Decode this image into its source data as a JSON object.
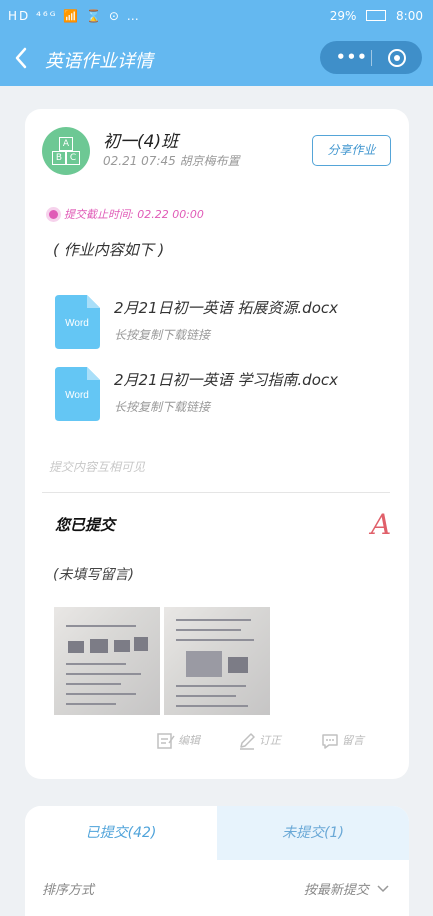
{
  "status_bar": {
    "left": "HD ⁴⁶ᴳ 📶 ⌛ ⊙ … ",
    "battery": "29%",
    "time": "8:00"
  },
  "nav": {
    "title": "英语作业详情",
    "more": "•••"
  },
  "homework": {
    "class_name": "初一(4)班",
    "meta": "02.21 07:45 胡京梅布置",
    "share_label": "分享作业",
    "deadline": "提交截止时间: 02.22 00:00",
    "content_title": "( 作业内容如下 )",
    "files": [
      {
        "name": "2月21日初一英语 拓展资源.docx",
        "hint": "长按复制下载链接",
        "icon_label": "Word"
      },
      {
        "name": "2月21日初一英语 学习指南.docx",
        "hint": "长按复制下载链接",
        "icon_label": "Word"
      }
    ],
    "visibility_note": "提交内容互相可见"
  },
  "submission": {
    "title": "您已提交",
    "grade": "A",
    "comment": "(未填写留言)",
    "actions": {
      "edit": "编辑",
      "revise": "订正",
      "message": "留言"
    }
  },
  "list": {
    "tabs": [
      {
        "label": "已提交(42)"
      },
      {
        "label": "未提交(1)"
      }
    ],
    "sort_label": "排序方式",
    "sort_value": "按最新提交"
  },
  "colors": {
    "primary": "#64b8f0",
    "accent": "#e05bb7",
    "grade": "#e0606a",
    "word_icon": "#64c6f4"
  }
}
